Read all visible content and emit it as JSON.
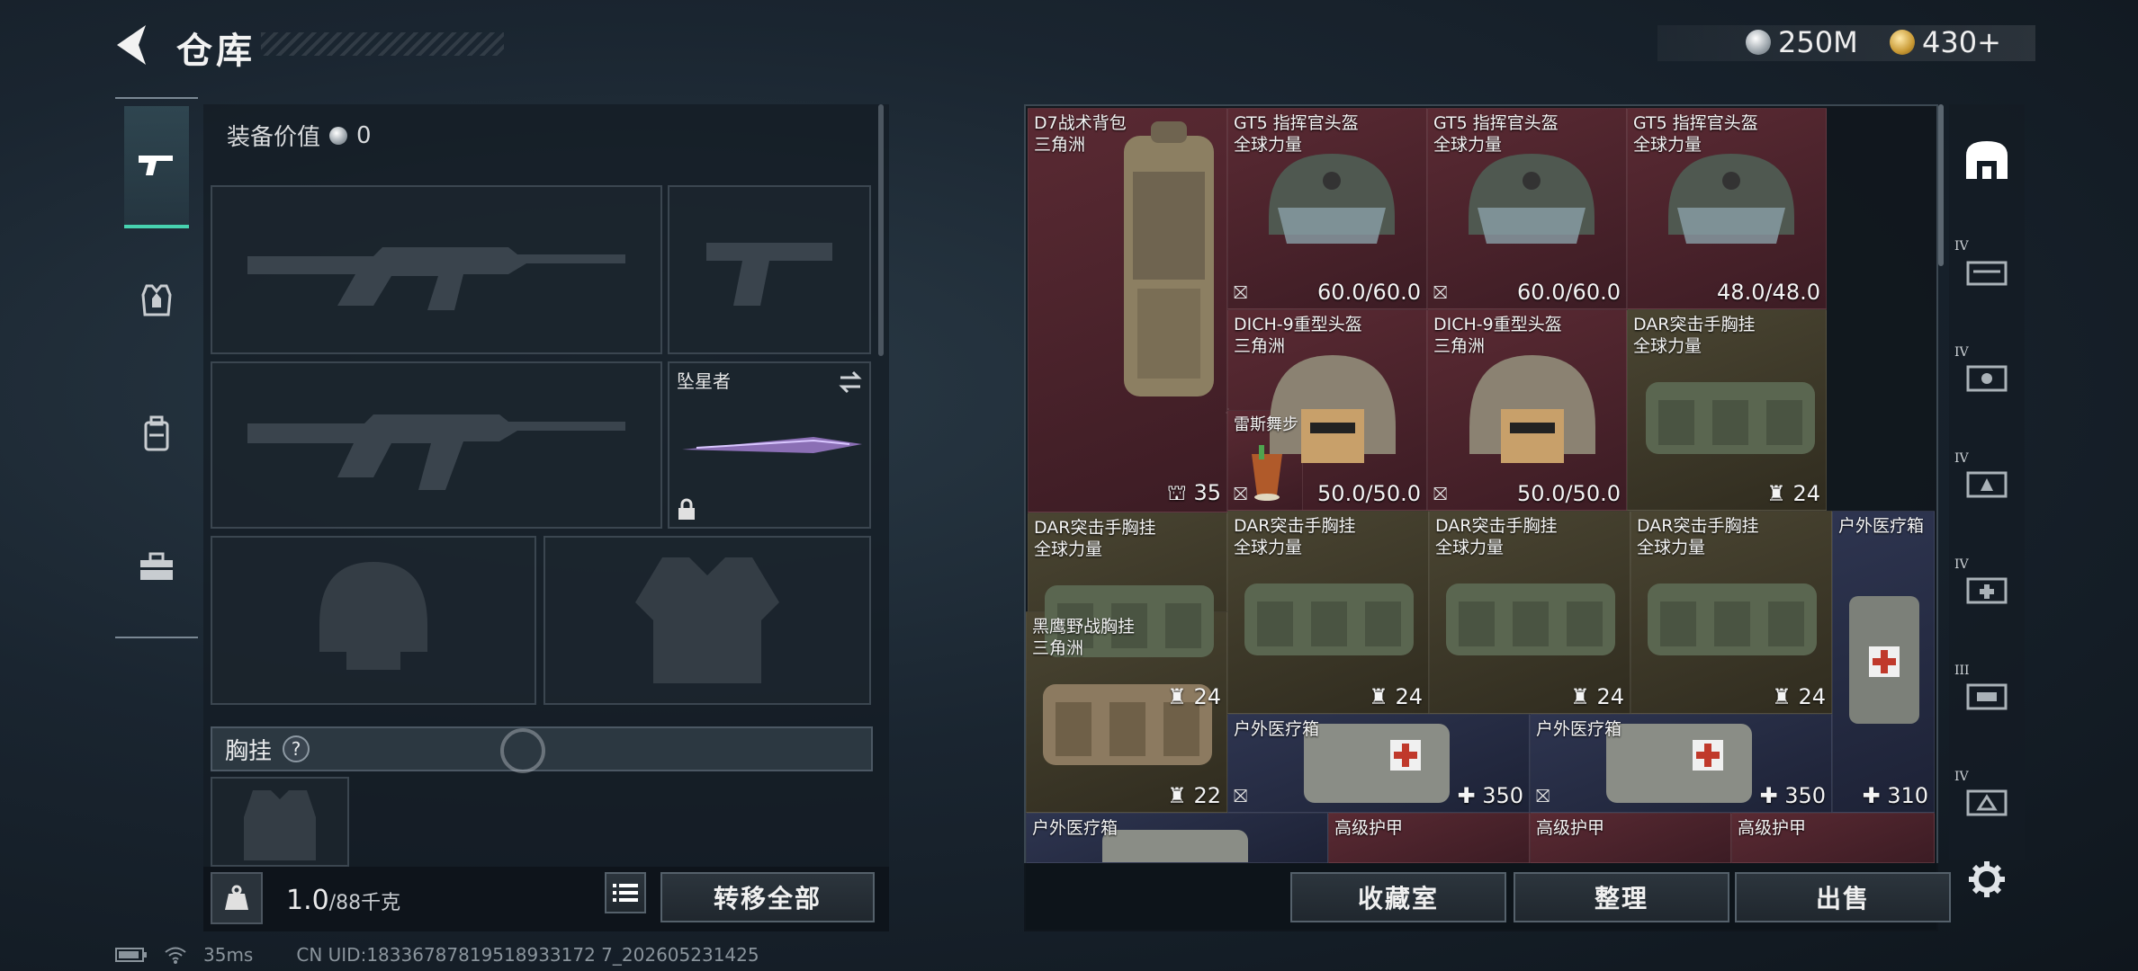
{
  "header": {
    "title": "仓库",
    "currency_silver": "250M",
    "currency_gold": "430+"
  },
  "left": {
    "equip_value_label": "装备价值",
    "equip_value": "0",
    "melee_name": "坠星者",
    "section_label": "胸挂",
    "section_help": "?",
    "weight_current": "1.0",
    "weight_max": "/88千克",
    "transfer_all": "转移全部"
  },
  "grid": {
    "items": [
      {
        "name": "D7战术背包",
        "sub": "三角洲",
        "value": "35",
        "icon": "capacity-icon"
      },
      {
        "name": "GT5 指挥官头盔",
        "sub": "全球力量",
        "value": "60.0/60.0",
        "icon": "durability-icon"
      },
      {
        "name": "GT5 指挥官头盔",
        "sub": "全球力量",
        "value": "60.0/60.0",
        "icon": "durability-icon"
      },
      {
        "name": "GT5 指挥官头盔",
        "sub": "全球力量",
        "value": "48.0/48.0",
        "icon": "durability-icon"
      },
      {
        "name": "DICH-9重型头盔",
        "sub": "三角洲",
        "value": "50.0/50.0",
        "icon": "durability-icon"
      },
      {
        "name": "DICH-9重型头盔",
        "sub": "三角洲",
        "value": "50.0/50.0",
        "icon": "durability-icon"
      },
      {
        "name": "DAR突击手胸挂",
        "sub": "全球力量",
        "value": "24",
        "icon": "vest-capacity-icon"
      },
      {
        "name": "DAR突击手胸挂",
        "sub": "全球力量",
        "value": "24",
        "icon": "vest-capacity-icon"
      },
      {
        "name": "雷斯舞步",
        "sub": "",
        "value": "",
        "icon": "drink-icon"
      },
      {
        "name": "DAR突击手胸挂",
        "sub": "全球力量",
        "value": "24",
        "icon": "vest-capacity-icon"
      },
      {
        "name": "DAR突击手胸挂",
        "sub": "全球力量",
        "value": "24",
        "icon": "vest-capacity-icon"
      },
      {
        "name": "DAR突击手胸挂",
        "sub": "全球力量",
        "value": "24",
        "icon": "vest-capacity-icon"
      },
      {
        "name": "户外医疗箱",
        "sub": "",
        "value": "310",
        "icon": "heal-icon"
      },
      {
        "name": "黑鹰野战胸挂",
        "sub": "三角洲",
        "value": "22",
        "icon": "vest-capacity-icon"
      },
      {
        "name": "户外医疗箱",
        "sub": "",
        "value": "350",
        "icon": "heal-icon"
      },
      {
        "name": "户外医疗箱",
        "sub": "",
        "value": "350",
        "icon": "heal-icon"
      },
      {
        "name": "户外医疗箱",
        "sub": "",
        "value": "",
        "icon": "heal-icon"
      },
      {
        "name": "高级护甲",
        "sub": "",
        "value": "",
        "icon": "armor-icon"
      },
      {
        "name": "高级护甲",
        "sub": "",
        "value": "",
        "icon": "armor-icon"
      },
      {
        "name": "高级护甲",
        "sub": "",
        "value": "",
        "icon": "armor-icon"
      }
    ]
  },
  "actions": {
    "collection": "收藏室",
    "sort": "整理",
    "sell": "出售"
  },
  "side_tiers": [
    "IV",
    "IV",
    "IV",
    "IV",
    "III",
    "IV"
  ],
  "footer": {
    "ping": "35ms",
    "uid": "CN UID:18336787819518933172 7_202605231425"
  },
  "colors": {
    "accent": "#47d3b0",
    "rarity_red": "#5a2a33",
    "rarity_olive": "#4a4532",
    "rarity_navy": "#2e3550"
  }
}
